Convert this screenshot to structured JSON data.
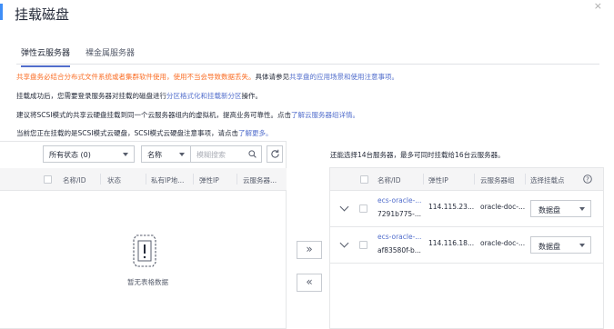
{
  "dialog": {
    "title": "挂载磁盘",
    "close": "×"
  },
  "tabs": [
    {
      "label": "弹性云服务器",
      "active": true
    },
    {
      "label": "裸金属服务器",
      "active": false
    }
  ],
  "notes": {
    "line1_warn": "共享盘务必结合分布式文件系统或者集群软件使用，使用不当会导致数据丢失。",
    "line1_text": "具体请参见",
    "line1_link": "共享盘的应用场景和使用注意事项。",
    "line2_text": "挂载成功后，您需要登录服务器对挂载的磁盘进行",
    "line2_link": "分区格式化和挂载新分区",
    "line2_end": "操作。",
    "line3_text": "建议将SCSI模式的共享云硬盘挂载到同一个云服务器组内的虚拟机，提高业务可靠性。点击",
    "line3_link": "了解云服务器组详情。",
    "line4_text": "当前您正在挂载的是SCSI模式云硬盘，SCSI模式云硬盘注意事项，请点击",
    "line4_link": "了解更多。"
  },
  "left": {
    "status_filter": "所有状态 (0)",
    "field_filter": "名称",
    "search_placeholder": "模糊搜索",
    "columns": [
      "名称/ID",
      "状态",
      "私有IP地...",
      "弹性IP",
      "云服务器..."
    ],
    "empty_text": "暂无表格数据"
  },
  "transfer": {
    "add": "»",
    "remove": "«"
  },
  "right": {
    "info": "还能选择14台服务器，最多可同时挂载给16台云服务器。",
    "columns": [
      "名称/ID",
      "弹性IP",
      "云服务器组",
      "选择挂载点"
    ],
    "rows": [
      {
        "name": "ecs-oracle-...",
        "id": "7291b775-...",
        "ip": "114.115.23...",
        "group": "oracle-doc-...",
        "mount": "数据盘"
      },
      {
        "name": "ecs-oracle-...",
        "id": "af83580f-b...",
        "ip": "114.116.18...",
        "group": "oracle-doc-...",
        "mount": "数据盘"
      }
    ]
  },
  "colors": {
    "accent": "#526ecc",
    "warn": "#fa6e26",
    "border": "#e5e6e8"
  }
}
